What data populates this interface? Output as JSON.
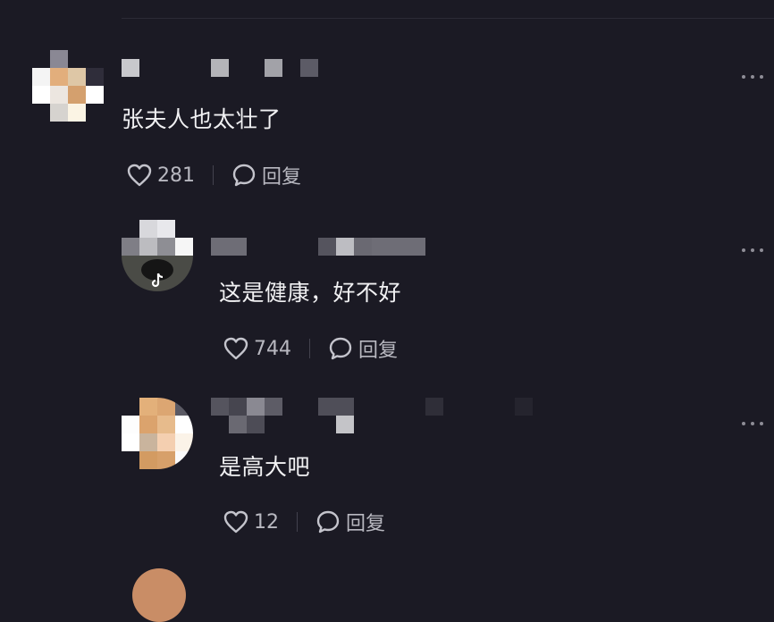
{
  "comments": [
    {
      "text": "张夫人也太壮了",
      "likes": "281",
      "reply_label": "回复"
    },
    {
      "text": "这是健康，好不好",
      "likes": "744",
      "reply_label": "回复"
    },
    {
      "text": "是高大吧",
      "likes": "12",
      "reply_label": "回复"
    }
  ],
  "colors": {
    "background": "#1b1a24",
    "text": "#f1f1f3",
    "muted": "#b8b8c0"
  },
  "icons": [
    "heart-icon",
    "comment-bubble-icon",
    "more-options-icon",
    "tiktok-logo-icon"
  ]
}
